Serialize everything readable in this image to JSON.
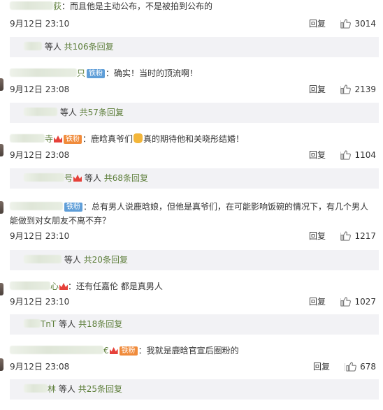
{
  "comments": [
    {
      "text": "：而且他是主动公布，不是被拍到公布的",
      "name_suffix": "荻",
      "badge": "",
      "time": "9月12日 23:10",
      "reply_label": "回复",
      "likes": "3014",
      "subreplies": {
        "prefix": "等人",
        "count": "共106条回复"
      }
    },
    {
      "text": "：确实！当时的顶流啊！",
      "name_suffix": "只",
      "badge": "铁粉",
      "time": "9月12日 23:08",
      "reply_label": "回复",
      "likes": "2139",
      "subreplies": {
        "prefix": "等人",
        "count": "共57条回复"
      }
    },
    {
      "text_a": "：鹿晗真爷们",
      "text_b": "真的期待他和关晓彤结婚！",
      "name_suffix": "寺",
      "badge": "铁粉",
      "time": "9月12日 23:08",
      "reply_label": "回复",
      "likes": "1104",
      "subreplies": {
        "prefix": "等人",
        "count": "共68条回复",
        "name_suffix": "号"
      }
    },
    {
      "text": "：总有男人说鹿晗娘，但他是真爷们，在可能影响饭碗的情况下，有几个男人能做到对女朋友不离不弃？",
      "badge": "铁粉",
      "time": "9月12日 23:10",
      "reply_label": "回复",
      "likes": "1217",
      "subreplies": {
        "prefix": "等人",
        "count": "共20条回复"
      }
    },
    {
      "text": "：还有任嘉伦 都是真男人",
      "name_suffix": "心",
      "time": "9月12日 23:10",
      "reply_label": "回复",
      "likes": "1027",
      "subreplies": {
        "prefix": "等人",
        "count": "共18条回复",
        "name_suffix": "TnT"
      }
    },
    {
      "text": "：我就是鹿晗官宣后圈粉的",
      "name_suffix": "€",
      "badge": "铁粉",
      "time": "9月12日 23:08",
      "reply_label": "回复",
      "likes": "678",
      "subreplies": {
        "prefix": "等人",
        "count": "共25条回复",
        "name_suffix": "林"
      }
    }
  ],
  "colors": {
    "username": "#5d7e3a",
    "badge_blue": "#5f9ed8",
    "badge_orange": "#f08b3b",
    "subbox_bg": "#f2f2f5"
  },
  "icons": {
    "like": "thumbs-up-icon",
    "vip": "crown-icon"
  }
}
